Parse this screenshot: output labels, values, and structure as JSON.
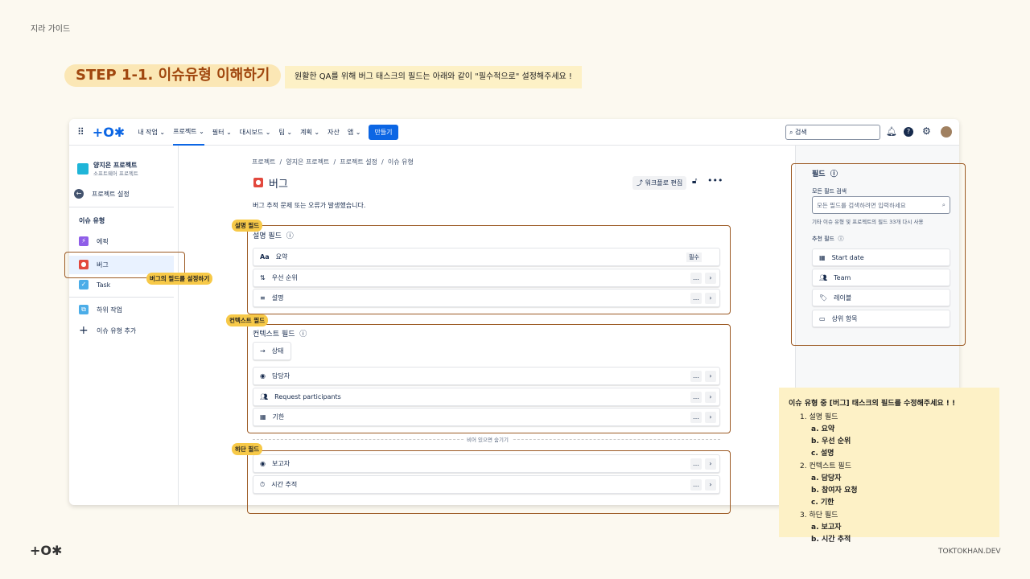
{
  "guide_title": "지라 가이드",
  "step_title": "STEP 1-1. 이슈유형 이해하기",
  "hint": "원활한 QA를 위해 버그 태스크의 필드는 아래와 같이 \"필수적으로\" 설정해주세요 !",
  "nav": {
    "items": [
      "내 작업",
      "프로젝트",
      "필터",
      "대시보드",
      "팀",
      "계획",
      "자산",
      "앱"
    ],
    "create": "만들기",
    "search": "검색"
  },
  "sidebar": {
    "project_name": "양지은 프로젝트",
    "project_type": "소프트웨어 프로젝트",
    "back": "프로젝트 설정",
    "section": "이슈 유형",
    "items": [
      "에픽",
      "버그",
      "Task",
      "하위 작업",
      "이슈 유형 추가"
    ]
  },
  "breadcrumb": [
    "프로젝트",
    "양지은 프로젝트",
    "프로젝트 설정",
    "이슈 유형"
  ],
  "page": {
    "title": "버그",
    "description": "버그 추적 문제 또는 오류가 발생했습니다.",
    "workflow_btn": "워크플로 편집"
  },
  "desc_section": {
    "title": "설명 필드",
    "fields": [
      "요약",
      "우선 순위",
      "설명"
    ],
    "required": "필수"
  },
  "context_section": {
    "title": "컨텍스트 필드",
    "status": "상태",
    "fields": [
      "담당자",
      "Request participants",
      "기한"
    ]
  },
  "hide_when_empty": "비어 있으면 숨기기",
  "bottom_fields": [
    "보고자",
    "시간 추적"
  ],
  "right": {
    "title": "필드",
    "search_label": "모든 필드 검색",
    "search_placeholder": "모든 필드를 검색하려면 입력하세요",
    "reuse": "기타 이슈 유형 및 프로젝트의 필드 33개 다시 사용",
    "suggested": "추천 필드",
    "items": [
      "Start date",
      "Team",
      "레이블",
      "상위 항목"
    ]
  },
  "tags": {
    "desc": "설명 필드",
    "context": "컨텍스트 필드",
    "bottom": "하단 필드",
    "bug": "버그의 필드를 설정하기"
  },
  "note": {
    "title": "이슈 유형 중 [버그] 태스크의 필드를 수정해주세요 ! !",
    "groups": [
      {
        "name": "1. 설명 필드",
        "items": [
          "a. 요약",
          "b. 우선 순위",
          "c. 설명"
        ]
      },
      {
        "name": "2. 컨텍스트 필드",
        "items": [
          "a. 담당자",
          "b. 참여자 요청",
          "c. 기한"
        ]
      },
      {
        "name": "3. 하단 필드",
        "items": [
          "a. 보고자",
          "b. 시간 추적"
        ]
      }
    ]
  },
  "footer": "TOKTOKHAN.DEV",
  "colors": {
    "accent": "#0c66e4",
    "orange": "#9c5a24",
    "tag": "#f7c948"
  }
}
